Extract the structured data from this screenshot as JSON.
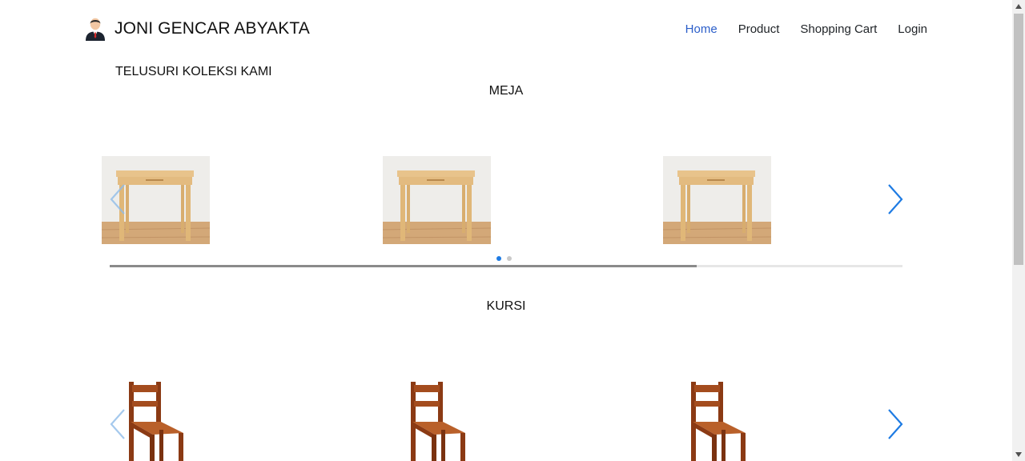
{
  "brand": {
    "name": "JONI GENCAR ABYAKTA",
    "logo_icon": "businessman-avatar-icon"
  },
  "nav": {
    "items": [
      {
        "label": "Home",
        "active": true
      },
      {
        "label": "Product",
        "active": false
      },
      {
        "label": "Shopping Cart",
        "active": false
      },
      {
        "label": "Login",
        "active": false
      }
    ],
    "active_color": "#2b5ec9"
  },
  "section_heading": "TELUSURI KOLEKSI KAMI",
  "categories": [
    {
      "title": "MEJA",
      "items": [
        {
          "image": "wooden-table"
        },
        {
          "image": "wooden-table"
        },
        {
          "image": "wooden-table"
        }
      ],
      "dots": {
        "count": 2,
        "active": 1
      },
      "scroll_progress": 0.74
    },
    {
      "title": "KURSI",
      "items": [
        {
          "image": "wooden-chair"
        },
        {
          "image": "wooden-chair"
        },
        {
          "image": "wooden-chair"
        }
      ]
    }
  ],
  "colors": {
    "carousel_arrow": "#1e7be3",
    "dot_active": "#1e7be3",
    "dot_inactive": "#c9c9c9"
  }
}
